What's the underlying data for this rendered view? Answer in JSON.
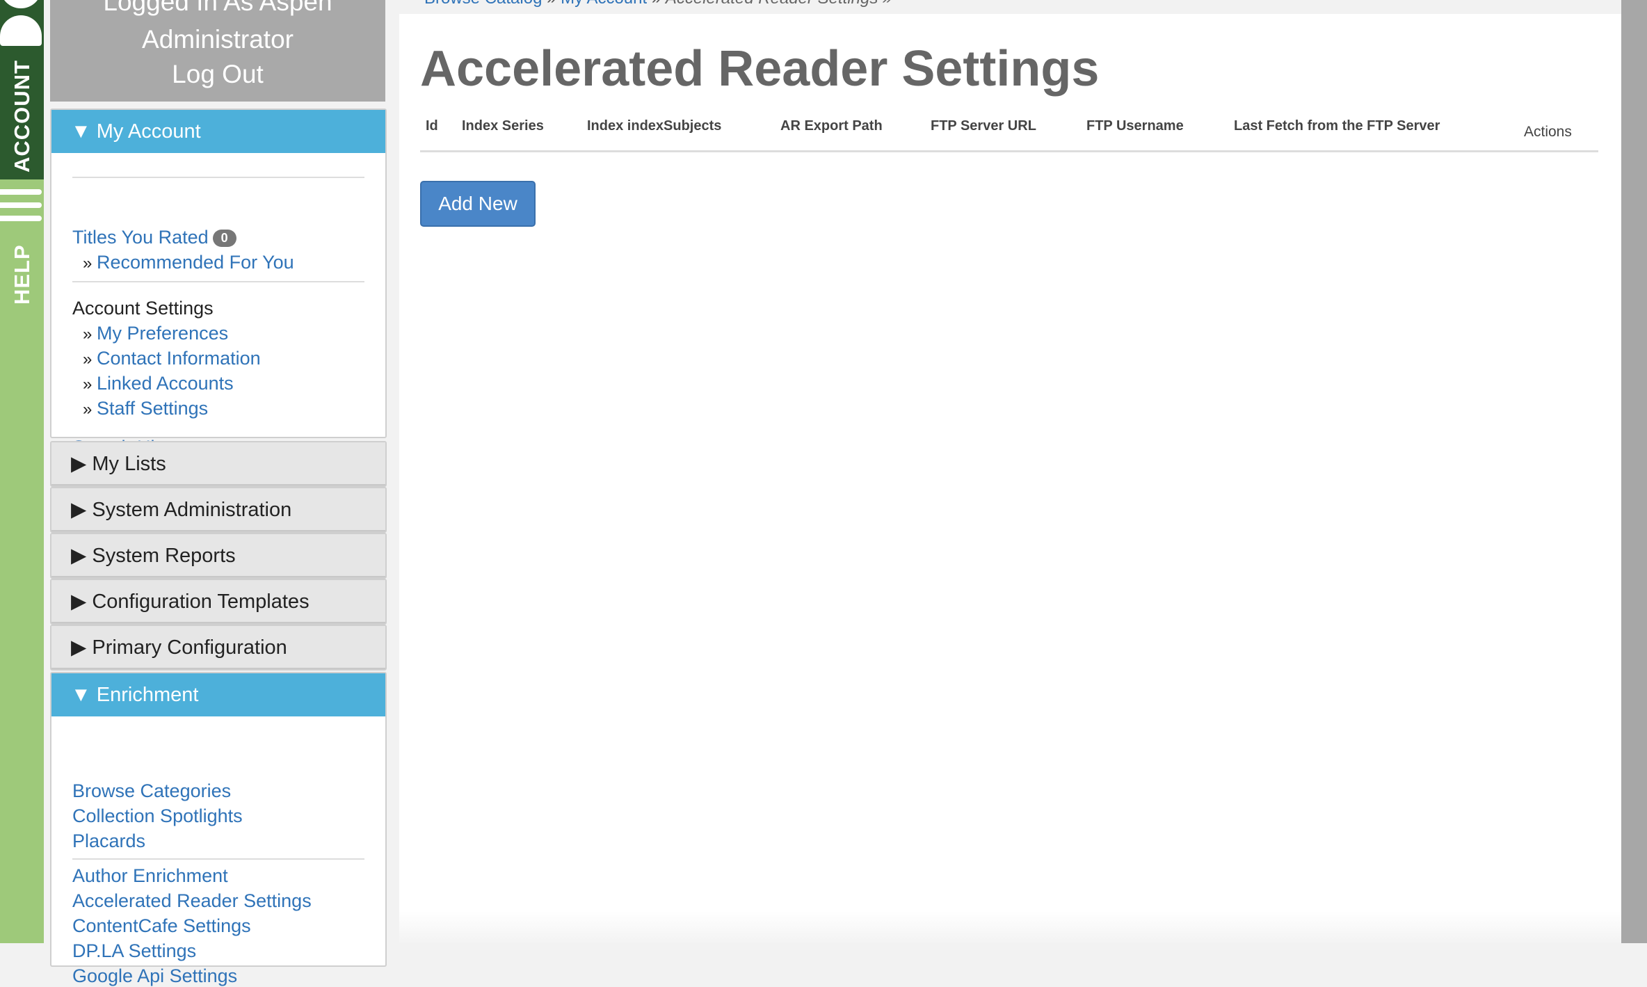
{
  "left_tabs": {
    "account": "ACCOUNT",
    "help": "HELP"
  },
  "login": {
    "line1": "Logged In As Aspen",
    "line2": "Administrator",
    "logout": "Log Out"
  },
  "my_account": {
    "header": "▼ My Account",
    "titles_rated": "Titles You Rated",
    "titles_rated_count": "0",
    "recommended": "Recommended For You",
    "account_settings": "Account Settings",
    "settings_links": [
      "My Preferences",
      "Contact Information",
      "Linked Accounts",
      "Staff Settings"
    ],
    "search_history": "Search History",
    "bullet": "»"
  },
  "collapsed_sections": [
    "▶ My Lists",
    "▶ System Administration",
    "▶ System Reports",
    "▶ Configuration Templates",
    "▶ Primary Configuration"
  ],
  "enrichment": {
    "header": "▼ Enrichment",
    "group1": [
      "Browse Categories",
      "Collection Spotlights",
      "Placards"
    ],
    "group2": [
      "Author Enrichment",
      "Accelerated Reader Settings",
      "ContentCafe Settings",
      "DP.LA Settings",
      "Google Api Settings"
    ]
  },
  "breadcrumb": {
    "home": "Browse Catalog",
    "sep": " » ",
    "account": "My Account",
    "current": "Accelerated Reader Settings »"
  },
  "page_title": "Accelerated Reader Settings",
  "table": {
    "columns": [
      "Id",
      "Index Series",
      "Index indexSubjects",
      "AR Export Path",
      "FTP Server URL",
      "FTP Username",
      "Last Fetch from the FTP Server"
    ],
    "actions": "Actions"
  },
  "add_new": "Add New"
}
